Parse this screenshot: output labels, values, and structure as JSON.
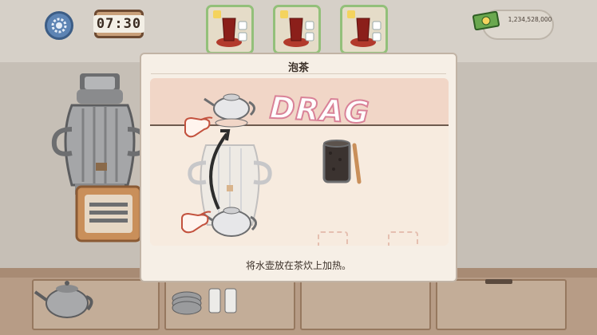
{
  "hud": {
    "clock_time": "07:30",
    "money_amount": "1,234,528,000",
    "settings_icon": "gear-icon",
    "orders": [
      {
        "item": "tea-glass-icon"
      },
      {
        "item": "tea-glass-icon"
      },
      {
        "item": "tea-glass-icon"
      }
    ]
  },
  "tutorial": {
    "title": "泡茶",
    "drag_label": "DRAG",
    "instruction": "将水壶放在茶炊上加热。"
  },
  "colors": {
    "accent_pink": "#d98298",
    "order_border": "#93c07a",
    "panel_band": "#f1d6c7"
  }
}
